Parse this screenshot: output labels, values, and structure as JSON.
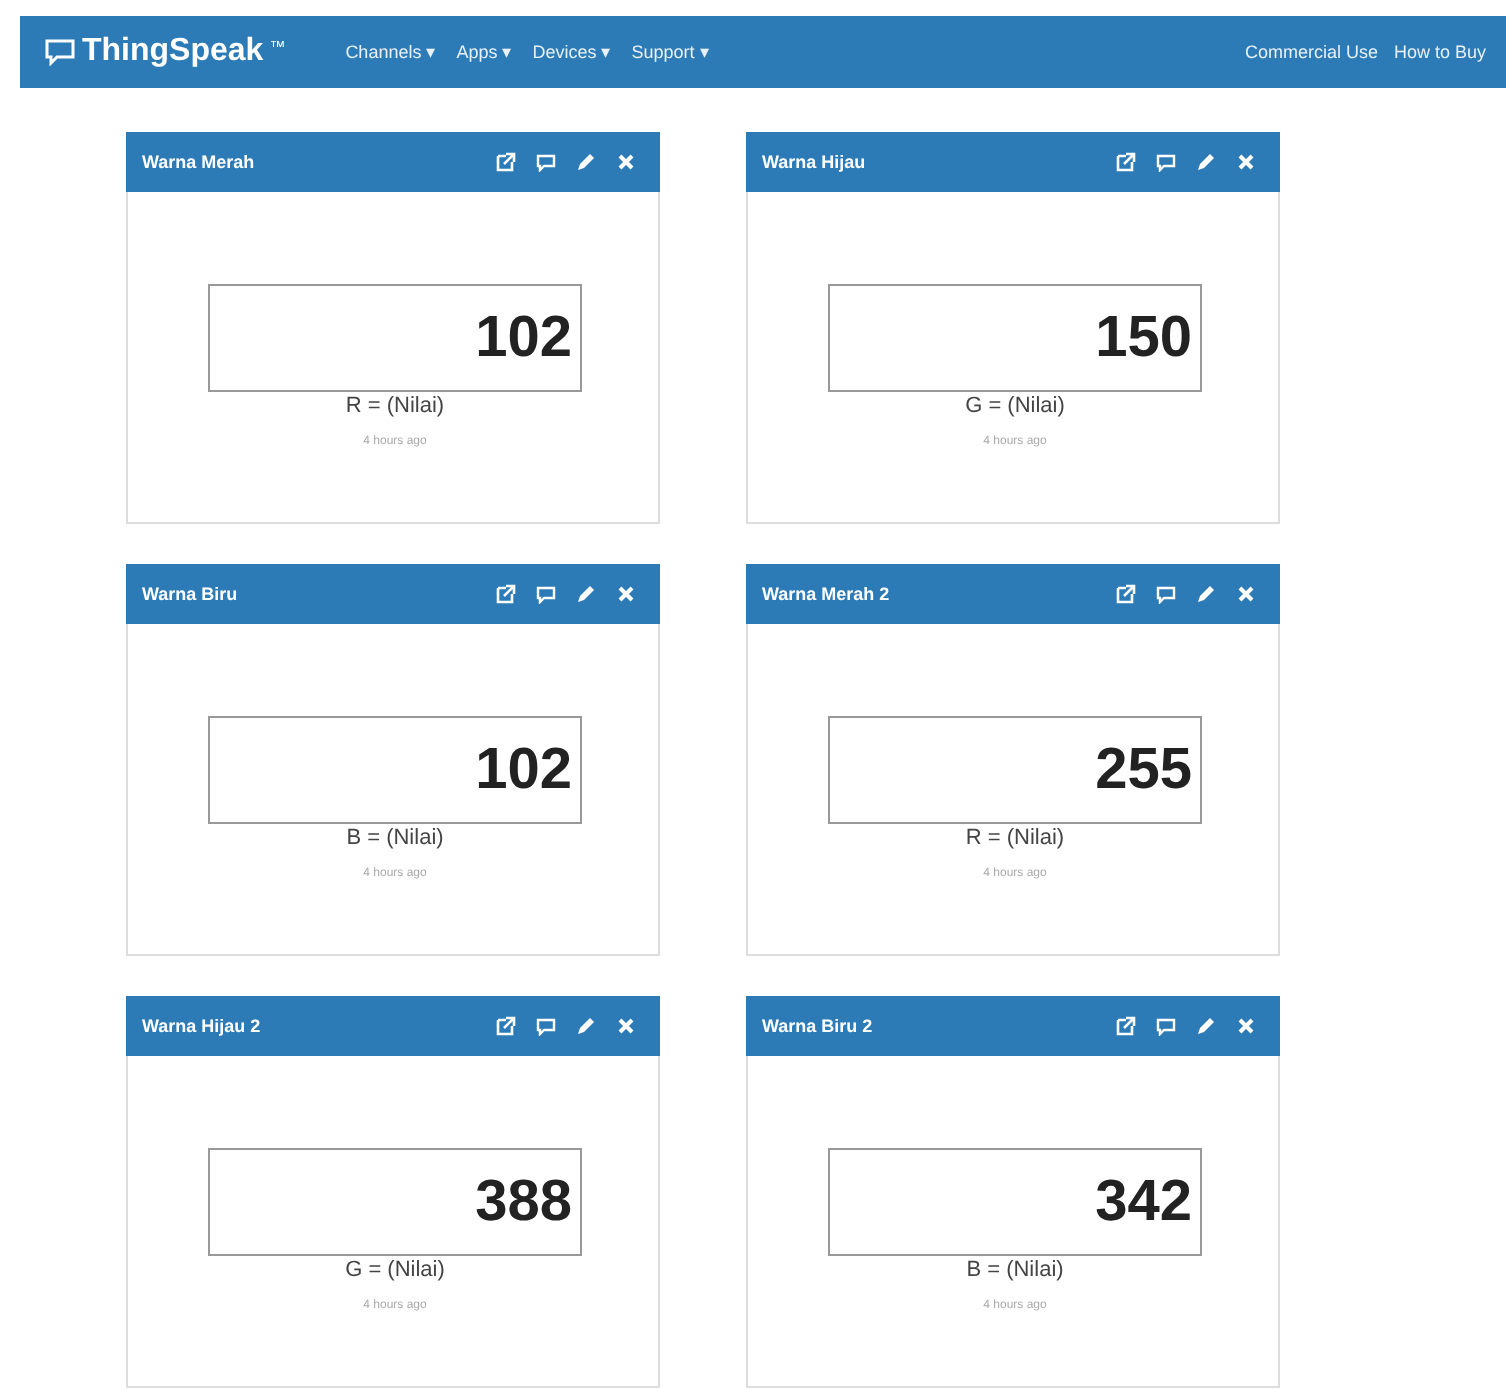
{
  "navbar": {
    "brand": "ThingSpeak",
    "brand_mark": "™",
    "menus": [
      {
        "label": "Channels",
        "caret": "▾"
      },
      {
        "label": "Apps",
        "caret": "▾"
      },
      {
        "label": "Devices",
        "caret": "▾"
      },
      {
        "label": "Support",
        "caret": "▾"
      }
    ],
    "right_links": [
      "Commercial Use",
      "How to Buy"
    ]
  },
  "widgets": [
    {
      "title": "Warna Merah",
      "value": "102",
      "label": "R = (Nilai)",
      "updated": "4 hours ago"
    },
    {
      "title": "Warna Hijau",
      "value": "150",
      "label": "G = (Nilai)",
      "updated": "4 hours ago"
    },
    {
      "title": "Warna Biru",
      "value": "102",
      "label": "B = (Nilai)",
      "updated": "4 hours ago"
    },
    {
      "title": "Warna Merah 2",
      "value": "255",
      "label": "R = (Nilai)",
      "updated": "4 hours ago"
    },
    {
      "title": "Warna Hijau 2",
      "value": "388",
      "label": "G = (Nilai)",
      "updated": "4 hours ago"
    },
    {
      "title": "Warna Biru 2",
      "value": "342",
      "label": "B = (Nilai)",
      "updated": "4 hours ago"
    }
  ]
}
